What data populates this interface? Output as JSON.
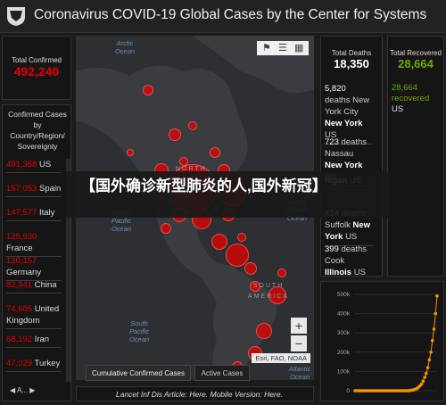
{
  "header": {
    "title": "Coronavirus COVID-19 Global Cases by the Center for Systems"
  },
  "total_confirmed": {
    "label": "Total Confirmed",
    "value": "492,240"
  },
  "confirmed_by_country": {
    "heading": "Confirmed Cases by Country/Region/ Sovereignty",
    "items": [
      {
        "num": "491,358",
        "name": "US"
      },
      {
        "num": "157,053",
        "name": "Spain"
      },
      {
        "num": "147,577",
        "name": "Italy"
      },
      {
        "num": "125,930",
        "name": "France"
      },
      {
        "num": "120,157",
        "name": "Germany"
      },
      {
        "num": "82,941",
        "name": "China"
      },
      {
        "num": "74,605",
        "name": "United Kingdom"
      },
      {
        "num": "68,192",
        "name": "Iran"
      },
      {
        "num": "47,029",
        "name": "Turkey"
      }
    ],
    "pager": "A..."
  },
  "map": {
    "ocean_labels": [
      "Arctic Ocean",
      "North Pacific Ocean",
      "North Atlantic Ocean",
      "South Pacific Ocean",
      "South Atlantic Ocean"
    ],
    "continent_labels": [
      "NORTH",
      "SOUTH AMERICA"
    ],
    "attribution": "Esri, FAO, NOAA",
    "zoom_in": "+",
    "zoom_out": "−"
  },
  "tabs": [
    {
      "label": "Cumulative Confirmed Cases"
    },
    {
      "label": "Active Cases"
    }
  ],
  "deaths": {
    "label": "Total Deaths",
    "value": "18,350",
    "items": [
      {
        "num": "5,820",
        "text": "deaths New York City",
        "place": "New York",
        "country": "US"
      },
      {
        "num": "723",
        "text": "deaths Nassau",
        "place": "New York",
        "country": "US"
      },
      {
        "num": "",
        "text": "",
        "place": "higan",
        "country": "US"
      },
      {
        "num": "414",
        "text": "deaths Suffolk",
        "place": "New York",
        "country": "US"
      },
      {
        "num": "399",
        "text": "deaths Cook",
        "place": "Illinois",
        "country": "US"
      }
    ]
  },
  "recovered": {
    "label": "Total Recovered",
    "value": "28,664",
    "items": [
      {
        "num": "28,664",
        "text": "recovered",
        "country": "US"
      }
    ]
  },
  "growth_chart": {
    "chart_data": {
      "type": "line",
      "title": "",
      "xlabel": "",
      "ylabel": "",
      "ylim": [
        0,
        500000
      ],
      "y_ticks": [
        "500k",
        "400k",
        "300k",
        "200k",
        "100k",
        "0"
      ],
      "series": [
        {
          "values": [
            0,
            0,
            0,
            0,
            0,
            0,
            0,
            0,
            0,
            0,
            0,
            0,
            0,
            0,
            0,
            0,
            0,
            0,
            0,
            0,
            0,
            0,
            0,
            0,
            0,
            0,
            0,
            0,
            0,
            0,
            0,
            0,
            0,
            0,
            0,
            1,
            2,
            3,
            5,
            8,
            12,
            18,
            26,
            35,
            50,
            70,
            90,
            120,
            160,
            200,
            260,
            320,
            400,
            492
          ]
        }
      ],
      "values_unit_note": "thousands",
      "color": "#f29400"
    }
  },
  "footer": {
    "text": "Lancet Inf Dis Article: Here. Mobile Version: Here."
  },
  "overlay": {
    "text": "【国外确诊新型肺炎的人,国外新冠】"
  },
  "colors": {
    "confirmed": "#e60000",
    "recovered": "#70a800",
    "chart": "#f29400"
  }
}
